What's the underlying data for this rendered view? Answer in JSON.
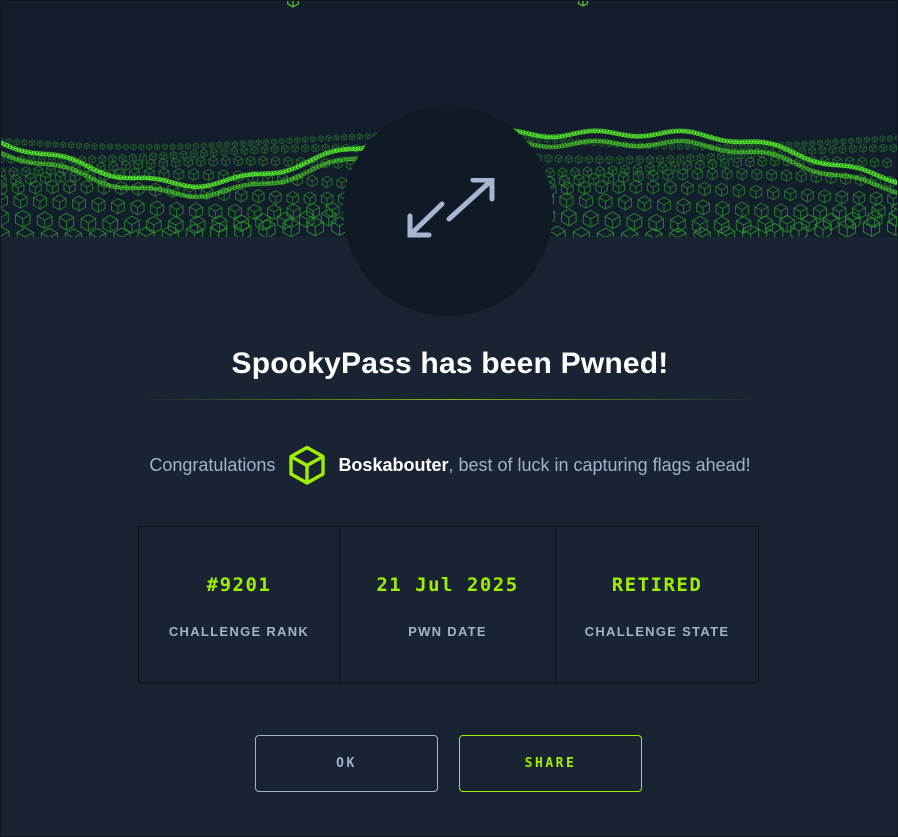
{
  "dialog": {
    "title": "SpookyPass has been Pwned!",
    "congrats_prefix": "Congratulations",
    "username": "Boskabouter",
    "congrats_suffix": ", best of luck in capturing flags ahead!"
  },
  "stats": [
    {
      "value": "#9201",
      "label": "CHALLENGE RANK"
    },
    {
      "value": "21 Jul 2025",
      "label": "PWN DATE"
    },
    {
      "value": "RETIRED",
      "label": "CHALLENGE STATE"
    }
  ],
  "buttons": {
    "ok_label": "OK",
    "share_label": "SHARE"
  },
  "icons": {
    "emblem": "expand-arrows-icon",
    "avatar": "cube-icon"
  },
  "colors": {
    "accent": "#9fef00",
    "background": "#1a2332",
    "text_muted": "#a4b1cd"
  }
}
